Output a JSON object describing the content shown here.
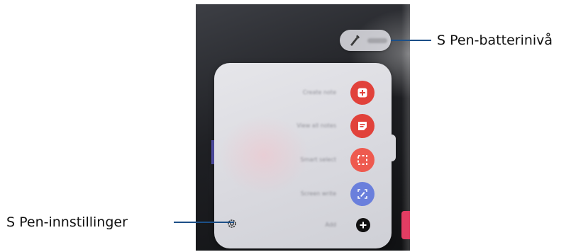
{
  "callouts": {
    "battery_level": "S Pen-batterinivå",
    "settings": "S Pen-innstillinger"
  },
  "battery_indicator": {
    "icon": "s-pen-icon",
    "level_text": "·····"
  },
  "air_command": {
    "items": [
      {
        "label": "Create note",
        "icon": "create-note-icon",
        "color": "#e1423b"
      },
      {
        "label": "View all notes",
        "icon": "view-notes-icon",
        "color": "#e1423b"
      },
      {
        "label": "Smart select",
        "icon": "smart-select-icon",
        "color": "#ee5a4f"
      },
      {
        "label": "Screen write",
        "icon": "screen-write-icon",
        "color": "#6a7fdc"
      },
      {
        "label": "Add",
        "icon": "add-icon",
        "color": "#111111"
      }
    ],
    "settings_icon": "gear-icon"
  },
  "colors": {
    "callout_line": "#1c4f87",
    "panel_bg": "#dcdce1"
  }
}
